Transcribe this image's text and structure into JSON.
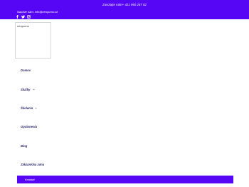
{
  "topbar": {
    "phone_text": "Zavolajte nám+ 421 950 267 02",
    "email_text": "Napíšte nám: info@neoporno.sk",
    "social_icons": [
      "facebook-icon",
      "twitter-icon",
      "instagram-icon"
    ]
  },
  "logo": {
    "alt_text": "neoporno"
  },
  "nav": {
    "items": [
      {
        "label": "Domov",
        "has_dropdown": false
      },
      {
        "label": "Služby",
        "has_dropdown": true
      },
      {
        "label": "Školenia",
        "has_dropdown": true
      },
      {
        "label": "Oprávnenia",
        "has_dropdown": false
      },
      {
        "label": "Blog",
        "has_dropdown": false
      },
      {
        "label": "Zákaznícka zóna",
        "has_dropdown": false
      }
    ]
  },
  "contact_button": {
    "label": "Kontakt"
  },
  "colors": {
    "brand": "#5606f5",
    "nav_text": "#2a2a6a",
    "background": "#ffffff"
  }
}
